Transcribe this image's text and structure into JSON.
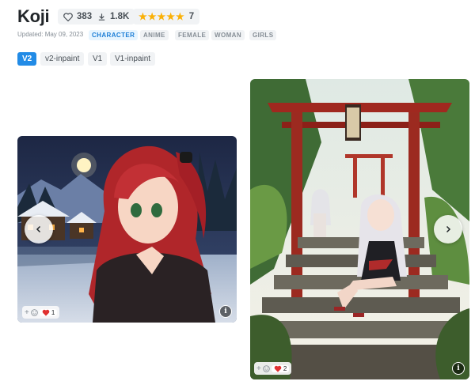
{
  "model": {
    "title": "Koji",
    "likes": "383",
    "downloads": "1.8K",
    "rating_count": "7",
    "stars": "★★★★★",
    "updated": "Updated: May 09, 2023",
    "tags": [
      "CHARACTER",
      "ANIME",
      "FEMALE",
      "WOMAN",
      "GIRLS"
    ]
  },
  "versions": [
    "V2",
    "v2-inpaint",
    "V1",
    "V1-inpaint"
  ],
  "active_version": "V2",
  "gallery": {
    "card1": {
      "reaction_count": "1",
      "add_icon": "+",
      "info": "i"
    },
    "card2": {
      "reaction_count": "2",
      "add_icon": "+",
      "info": "i"
    },
    "prev_icon": "chevron-left-icon",
    "next_icon": "chevron-right-icon"
  },
  "colors": {
    "accent": "#228be6",
    "star": "#fab005",
    "heart": "#e03131"
  }
}
